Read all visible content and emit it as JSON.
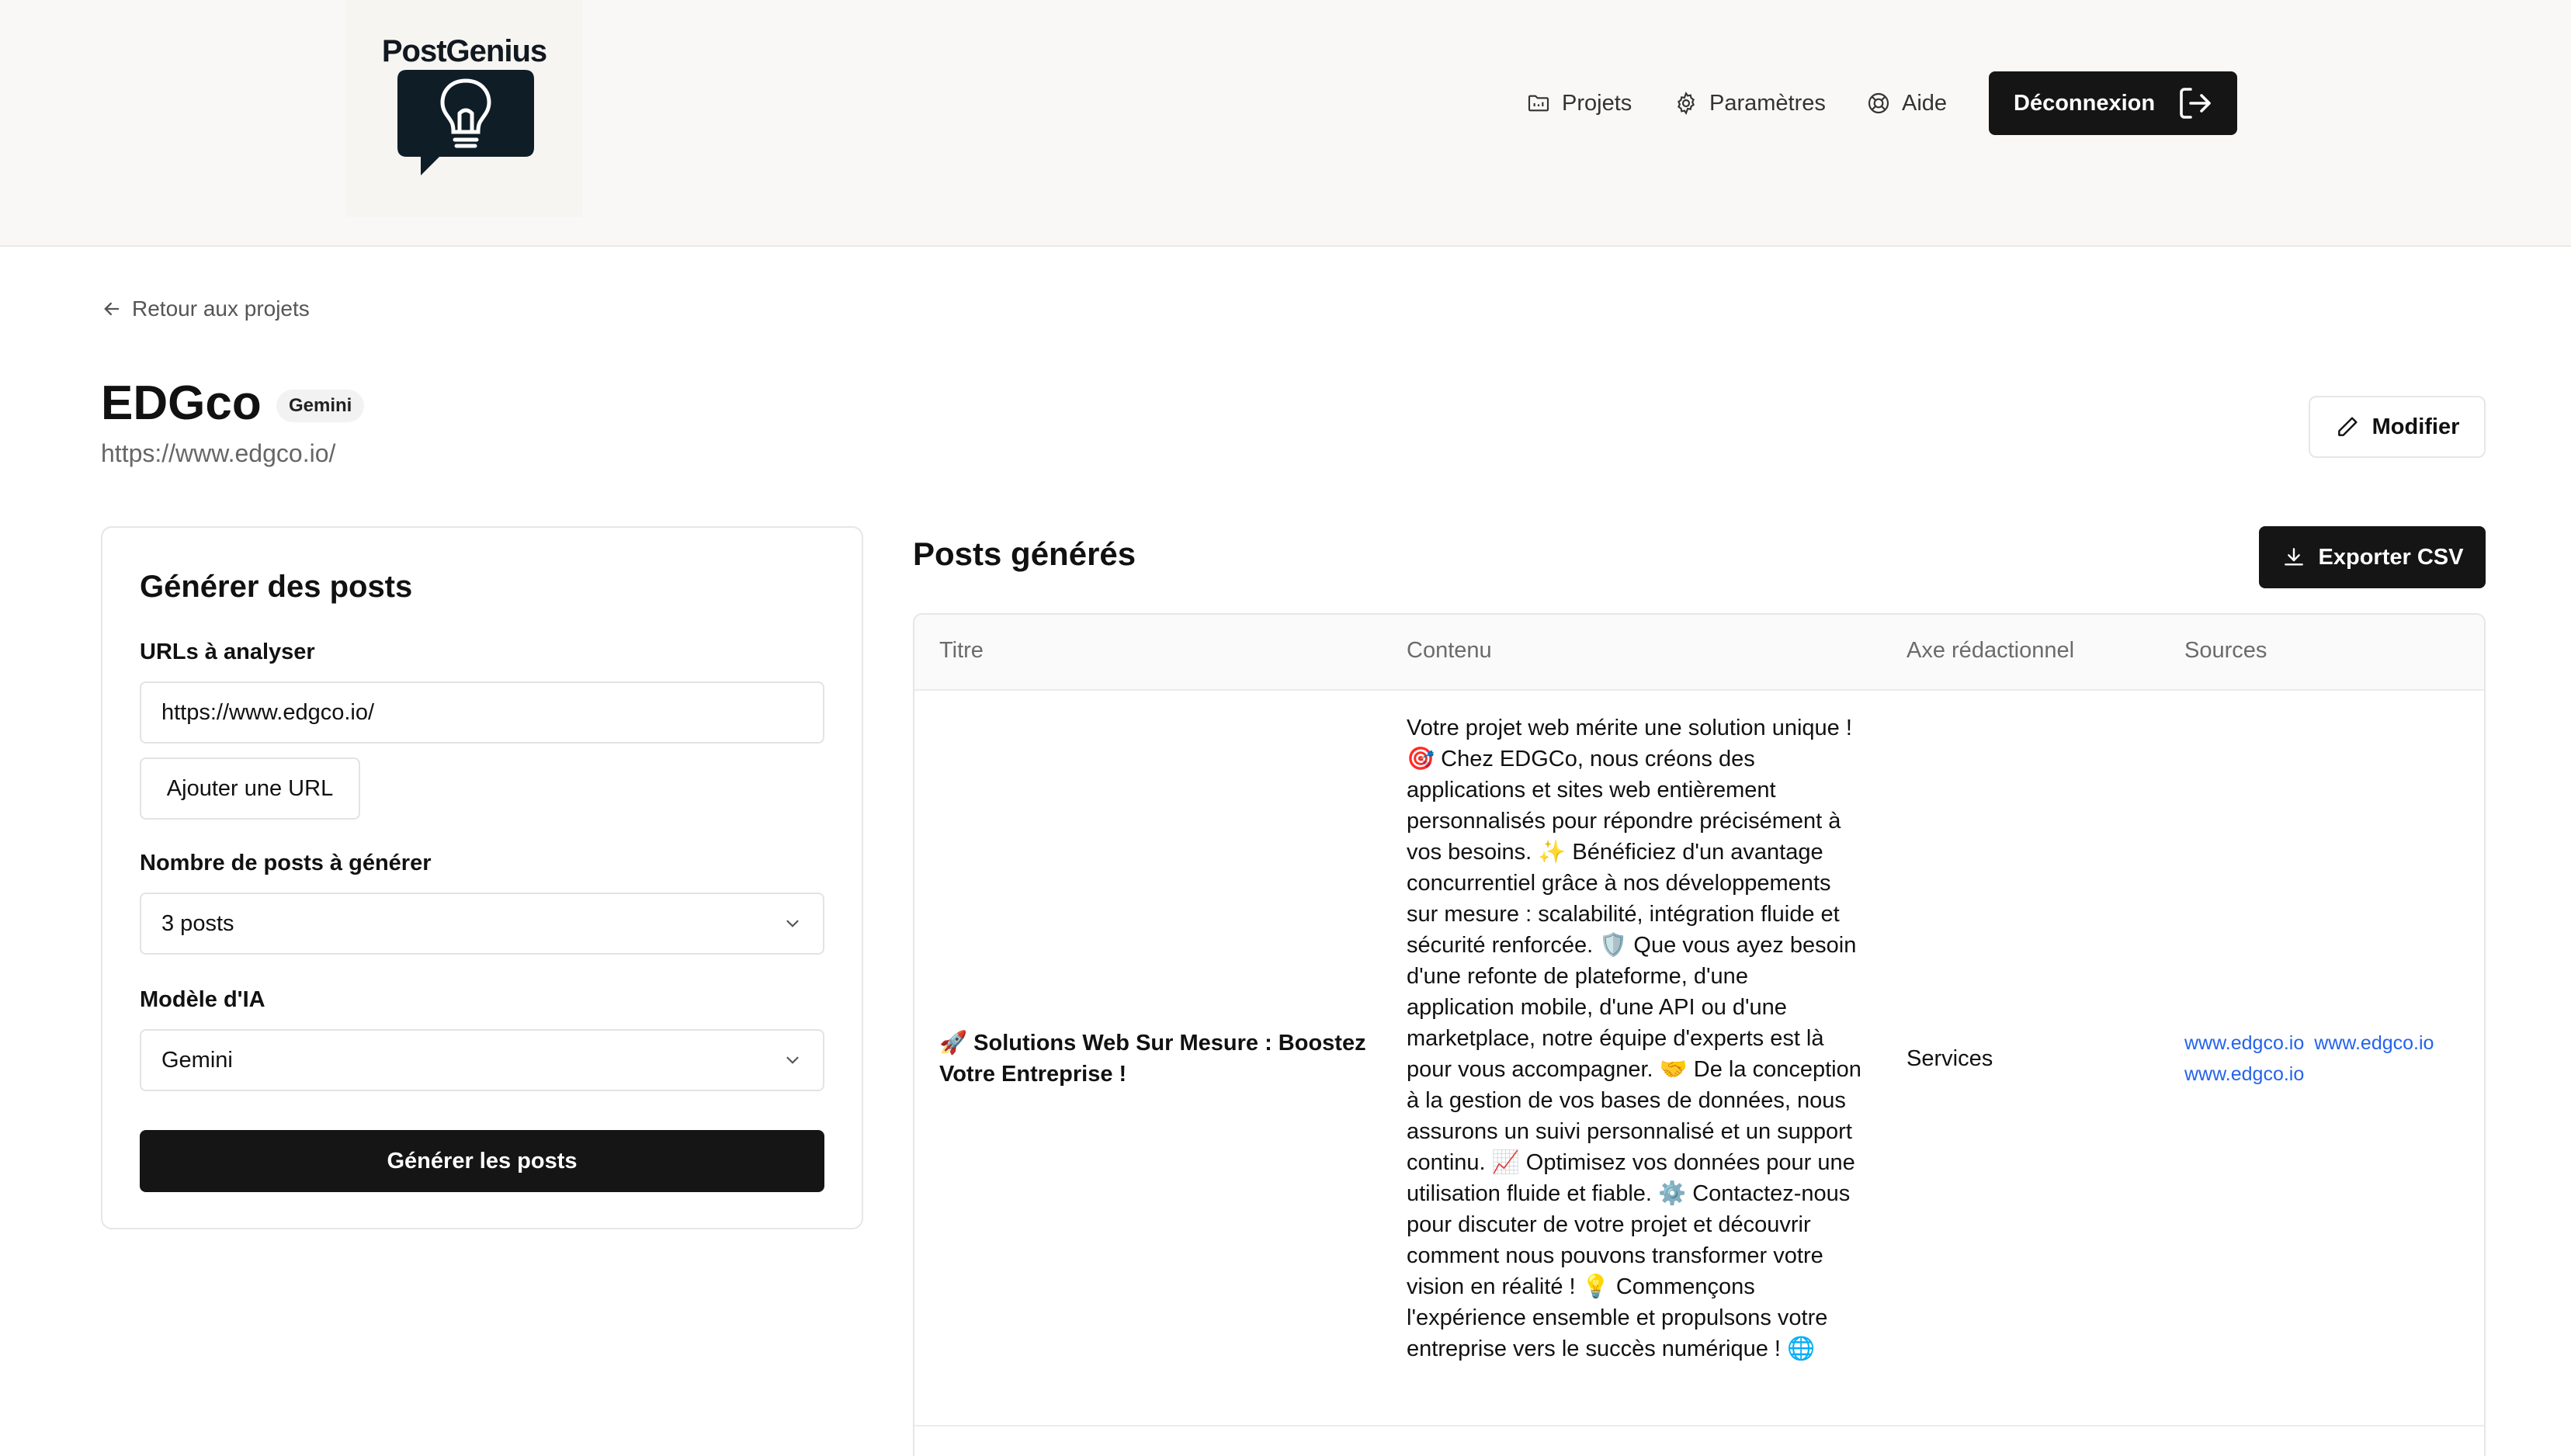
{
  "brand": {
    "name": "PostGenius"
  },
  "nav": {
    "projects_label": "Projets",
    "settings_label": "Paramètres",
    "help_label": "Aide",
    "logout_label": "Déconnexion"
  },
  "back": {
    "label": "Retour aux projets"
  },
  "project": {
    "name": "EDGco",
    "model_badge": "Gemini",
    "url": "https://www.edgco.io/",
    "edit_label": "Modifier"
  },
  "generator": {
    "title": "Générer des posts",
    "urls_label": "URLs à analyser",
    "url_value": "https://www.edgco.io/",
    "add_url_label": "Ajouter une URL",
    "count_label": "Nombre de posts à générer",
    "count_value": "3 posts",
    "model_label": "Modèle d'IA",
    "model_value": "Gemini",
    "submit_label": "Générer les posts"
  },
  "posts": {
    "title": "Posts générés",
    "export_label": "Exporter CSV",
    "columns": [
      "Titre",
      "Contenu",
      "Axe rédactionnel",
      "Sources"
    ],
    "rows": [
      {
        "title": "🚀 Solutions Web Sur Mesure : Boostez Votre Entreprise !",
        "content": "Votre projet web mérite une solution unique ! 🎯 Chez EDGCo, nous créons des applications et sites web entièrement personnalisés pour répondre précisément à vos besoins. ✨ Bénéficiez d'un avantage concurrentiel grâce à nos développements sur mesure : scalabilité, intégration fluide et sécurité renforcée. 🛡️ Que vous ayez besoin d'une refonte de plateforme, d'une application mobile, d'une API ou d'une marketplace, notre équipe d'experts est là pour vous accompagner. 🤝 De la conception à la gestion de vos bases de données, nous assurons un suivi personnalisé et un support continu. 📈 Optimisez vos données pour une utilisation fluide et fiable. ⚙️ Contactez-nous pour discuter de votre projet et découvrir comment nous pouvons transformer votre vision en réalité ! 💡 Commençons l'expérience ensemble et propulsons votre entreprise vers le succès numérique ! 🌐",
        "axis": "Services",
        "sources": [
          "www.edgco.io",
          "www.edgco.io",
          "www.edgco.io"
        ]
      }
    ]
  },
  "colors": {
    "primary": "#151515",
    "link": "#2563eb",
    "header_bg": "#f9f8f6",
    "border": "#e6e6e6"
  },
  "icons": [
    "folder-icon",
    "gear-icon",
    "lifebuoy-icon",
    "logout-icon",
    "arrow-left-icon",
    "pencil-icon",
    "download-icon",
    "chevron-down-icon",
    "lightbulb-icon"
  ]
}
